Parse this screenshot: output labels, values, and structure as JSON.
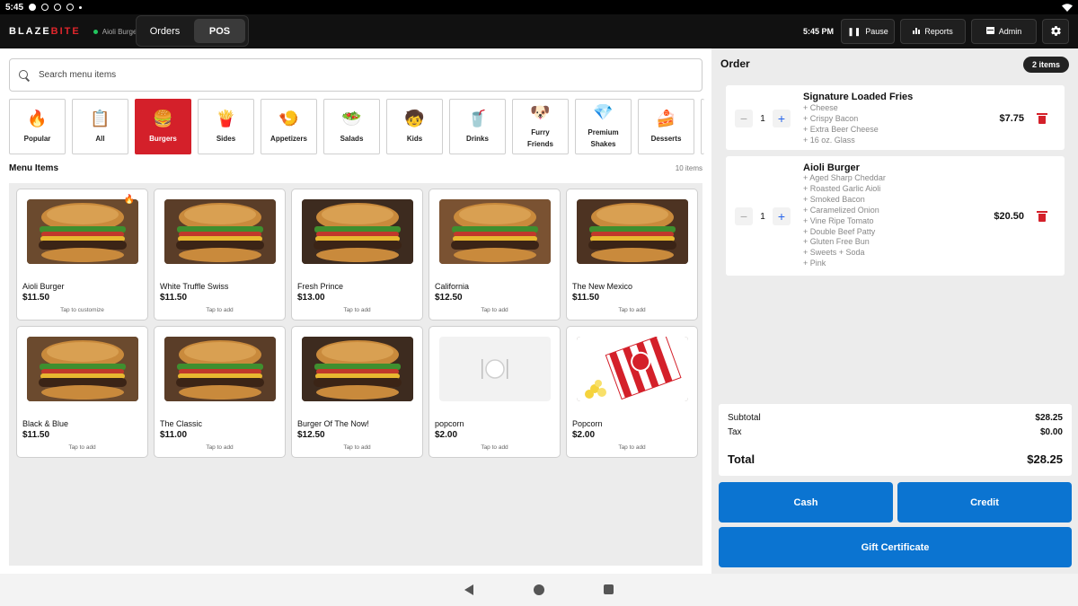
{
  "status_bar": {
    "time": "5:45"
  },
  "header": {
    "brand_left": "BLAZE",
    "brand_right": "BITE",
    "store_name": "Aioli Burgers",
    "tabs": [
      {
        "label": "Orders",
        "active": false
      },
      {
        "label": "POS",
        "active": true
      }
    ],
    "time": "5:45 PM",
    "buttons": {
      "pause": "Pause",
      "reports": "Reports",
      "admin": "Admin"
    },
    "icons": {
      "pause": "pause-icon",
      "reports": "bar-chart-icon",
      "admin": "admin-icon",
      "settings": "gear-icon"
    }
  },
  "search": {
    "placeholder": "Search menu items"
  },
  "categories": [
    {
      "label": "Popular",
      "icon": "🔥"
    },
    {
      "label": "All",
      "icon": "📋"
    },
    {
      "label": "Burgers",
      "icon": "🍔",
      "active": true
    },
    {
      "label": "Sides",
      "icon": "🍟"
    },
    {
      "label": "Appetizers",
      "icon": "🍤"
    },
    {
      "label": "Salads",
      "icon": "🥗"
    },
    {
      "label": "Kids",
      "icon": "🧒"
    },
    {
      "label": "Drinks",
      "icon": "🥤"
    },
    {
      "label": "Furry Friends",
      "icon": "🐶"
    },
    {
      "label": "Premium Shakes",
      "icon": "💎"
    },
    {
      "label": "Desserts",
      "icon": "🍰"
    }
  ],
  "menu": {
    "title": "Menu Items",
    "count": "10 items",
    "items": [
      {
        "name": "Aioli Burger",
        "price": "$11.50",
        "hint": "Tap to customize",
        "popular": true,
        "image": "burger"
      },
      {
        "name": "White Truffle Swiss",
        "price": "$11.50",
        "hint": "Tap to add",
        "image": "burger"
      },
      {
        "name": "Fresh Prince",
        "price": "$13.00",
        "hint": "Tap to add",
        "image": "burger"
      },
      {
        "name": "California",
        "price": "$12.50",
        "hint": "Tap to add",
        "image": "burger"
      },
      {
        "name": "The New Mexico",
        "price": "$11.50",
        "hint": "Tap to add",
        "image": "burger"
      },
      {
        "name": "Black & Blue",
        "price": "$11.50",
        "hint": "Tap to add",
        "image": "burger"
      },
      {
        "name": "The Classic",
        "price": "$11.00",
        "hint": "Tap to add",
        "image": "burger"
      },
      {
        "name": "Burger Of The Now!",
        "price": "$12.50",
        "hint": "Tap to add",
        "image": "burger"
      },
      {
        "name": "popcorn",
        "price": "$2.00",
        "hint": "Tap to add",
        "image": "placeholder"
      },
      {
        "name": "Popcorn",
        "price": "$2.00",
        "hint": "Tap to add",
        "image": "popcorn"
      }
    ]
  },
  "order": {
    "title": "Order",
    "badge": "2 items",
    "lines": [
      {
        "qty": "1",
        "name": "Signature Loaded Fries",
        "price": "$7.75",
        "mods": [
          "+ Cheese",
          "+ Crispy Bacon",
          "+ Extra Beer Cheese",
          "+ 16 oz. Glass"
        ]
      },
      {
        "qty": "1",
        "name": "Aioli Burger",
        "price": "$20.50",
        "mods": [
          "+ Aged Sharp Cheddar",
          "+ Roasted Garlic Aioli",
          "+ Smoked Bacon",
          "+ Caramelized Onion",
          "+ Vine Ripe Tomato",
          "+ Double Beef Patty",
          "+ Gluten Free Bun",
          "+ Sweets + Soda",
          "+ Pink"
        ]
      }
    ],
    "subtotal_label": "Subtotal",
    "subtotal": "$28.25",
    "tax_label": "Tax",
    "tax": "$0.00",
    "total_label": "Total",
    "total": "$28.25",
    "pay_buttons": {
      "cash": "Cash",
      "credit": "Credit",
      "gift": "Gift Certificate"
    }
  },
  "colors": {
    "accent_red": "#d4202a",
    "pay_blue": "#0b74d1",
    "header_bg": "#111111"
  }
}
